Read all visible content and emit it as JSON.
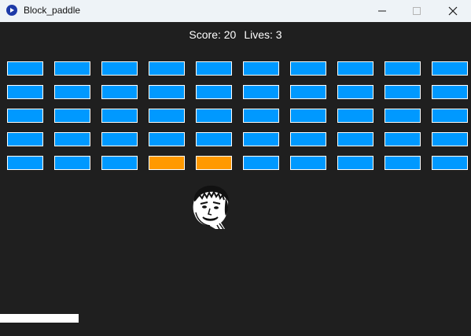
{
  "window": {
    "title": "Block_paddle",
    "icon": "play-circle-icon"
  },
  "titlebar_buttons": [
    "minimize-icon",
    "maximize-icon",
    "close-icon"
  ],
  "hud": {
    "score": "Score: 20",
    "lives": "Lives: 3"
  },
  "colors": {
    "background": "#1f1f1f",
    "brick": "#0099ff",
    "brick_hit": "#ff9900",
    "brick_border": "#ffffff",
    "paddle": "#ffffff",
    "hud_text": "#ffffff"
  },
  "bricks": {
    "rows": [
      [
        "blue",
        "blue",
        "blue",
        "blue",
        "blue",
        "blue",
        "blue",
        "blue",
        "blue",
        "blue"
      ],
      [
        "blue",
        "blue",
        "blue",
        "blue",
        "blue",
        "blue",
        "blue",
        "blue",
        "blue",
        "blue"
      ],
      [
        "blue",
        "blue",
        "blue",
        "blue",
        "blue",
        "blue",
        "blue",
        "blue",
        "blue",
        "blue"
      ],
      [
        "blue",
        "blue",
        "blue",
        "blue",
        "blue",
        "blue",
        "blue",
        "blue",
        "blue",
        "blue"
      ],
      [
        "blue",
        "blue",
        "blue",
        "orange",
        "orange",
        "blue",
        "blue",
        "blue",
        "blue",
        "blue"
      ]
    ]
  },
  "ball": {
    "sprite": "face-portrait-ball"
  }
}
